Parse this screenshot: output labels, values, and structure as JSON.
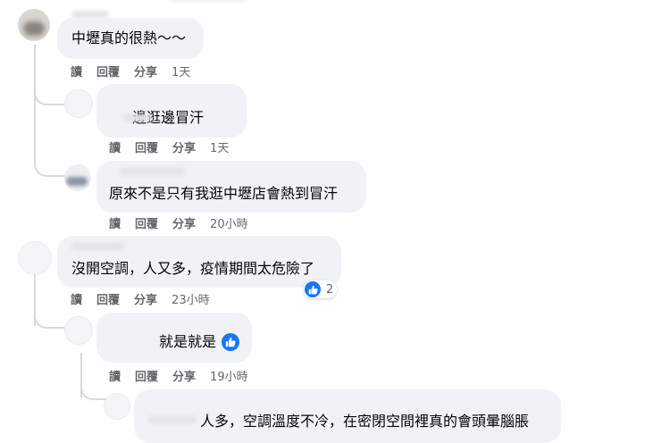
{
  "labels": {
    "read": "讀",
    "reply": "回覆",
    "share": "分享"
  },
  "comments": [
    {
      "text": "中壢真的很熱～～",
      "time": "1天"
    },
    {
      "text": "邊逛邊冒汗",
      "time": "1天"
    },
    {
      "text": "原來不是只有我逛中壢店會熱到冒汗",
      "time": "20小時"
    },
    {
      "text": "沒開空調，人又多，疫情期間太危險了",
      "time": "23小時",
      "reaction_count": "2"
    },
    {
      "text": "就是就是",
      "time": "19小時"
    },
    {
      "text": "人多，空調溫度不冷，在密閉空間裡真的會頭暈腦脹"
    }
  ],
  "colors": {
    "bubble": "#f0f2f5",
    "like_blue": "#1877f2",
    "meta_gray": "#65676b"
  },
  "icons": {
    "like": "thumbs-up-icon"
  }
}
